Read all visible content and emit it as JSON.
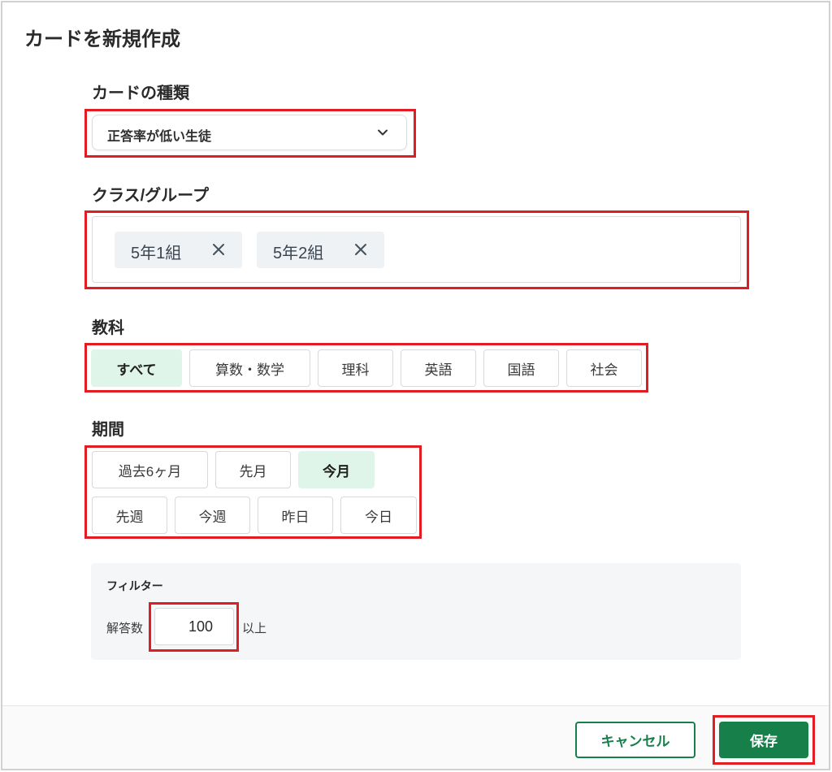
{
  "dialog": {
    "title": "カードを新規作成"
  },
  "card_type": {
    "label": "カードの種類",
    "selected": "正答率が低い生徒"
  },
  "class_group": {
    "label": "クラス/グループ",
    "chips": [
      {
        "label": "5年1組"
      },
      {
        "label": "5年2組"
      }
    ]
  },
  "subject": {
    "label": "教科",
    "options": [
      {
        "label": "すべて",
        "selected": true
      },
      {
        "label": "算数・数学",
        "selected": false
      },
      {
        "label": "理科",
        "selected": false
      },
      {
        "label": "英語",
        "selected": false
      },
      {
        "label": "国語",
        "selected": false
      },
      {
        "label": "社会",
        "selected": false
      }
    ]
  },
  "period": {
    "label": "期間",
    "options": [
      {
        "label": "過去6ヶ月",
        "selected": false
      },
      {
        "label": "先月",
        "selected": false
      },
      {
        "label": "今月",
        "selected": true
      },
      {
        "label": "先週",
        "selected": false
      },
      {
        "label": "今週",
        "selected": false
      },
      {
        "label": "昨日",
        "selected": false
      },
      {
        "label": "今日",
        "selected": false
      }
    ]
  },
  "filter": {
    "title": "フィルター",
    "answers_label": "解答数",
    "value": "100",
    "suffix": "以上"
  },
  "footer": {
    "cancel_label": "キャンセル",
    "save_label": "保存"
  },
  "icons": {
    "select_chevron": "chevron-down-icon",
    "chip_remove": "close-icon"
  },
  "colors": {
    "accent": "#17804a",
    "selected_bg": "#dff5ea",
    "annotation": "#e31b23",
    "chip_bg": "#eef2f5"
  }
}
